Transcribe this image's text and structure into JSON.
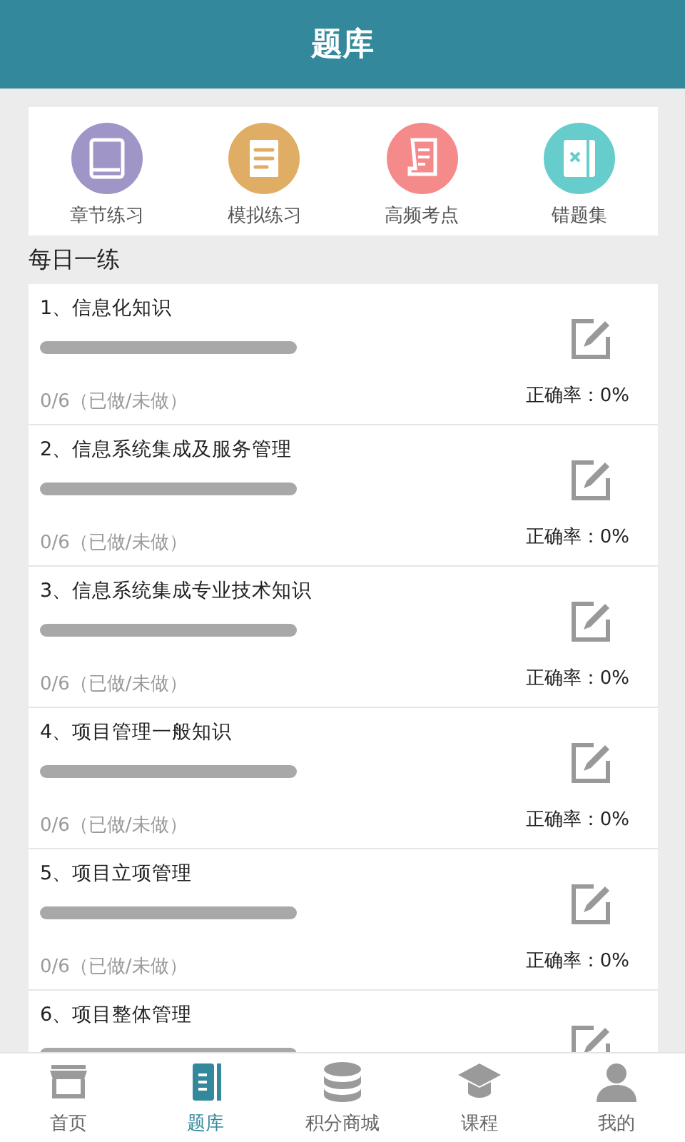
{
  "header": {
    "title": "题库"
  },
  "shortcuts": [
    {
      "label": "章节练习",
      "kind": "book",
      "color": "#9f95c6"
    },
    {
      "label": "模拟练习",
      "kind": "doc",
      "color": "#e0ad64"
    },
    {
      "label": "高频考点",
      "kind": "scroll",
      "color": "#f58a8a"
    },
    {
      "label": "错题集",
      "kind": "wrong",
      "color": "#66cccc"
    }
  ],
  "section": {
    "title": "每日一练"
  },
  "items": [
    {
      "title": "1、信息化知识",
      "level": 0,
      "stats": "0/6（已做/未做）",
      "accuracy": "正确率：0%"
    },
    {
      "title": "2、信息系统集成及服务管理",
      "level": 0,
      "stats": "0/6（已做/未做）",
      "accuracy": "正确率：0%"
    },
    {
      "title": "3、信息系统集成专业技术知识",
      "level": 0,
      "stats": "0/6（已做/未做）",
      "accuracy": "正确率：0%"
    },
    {
      "title": "4、项目管理一般知识",
      "level": 0,
      "stats": "0/6（已做/未做）",
      "accuracy": "正确率：0%"
    },
    {
      "title": "5、项目立项管理",
      "level": 0,
      "stats": "0/6（已做/未做）",
      "accuracy": "正确率：0%"
    },
    {
      "title": "6、项目整体管理",
      "level": 0
    }
  ],
  "nav": [
    {
      "label": "首页",
      "kind": "store",
      "selected": false
    },
    {
      "label": "题库",
      "kind": "book",
      "selected": true
    },
    {
      "label": "积分商城",
      "kind": "coins",
      "selected": false
    },
    {
      "label": "课程",
      "kind": "cap",
      "selected": false
    },
    {
      "label": "我的",
      "kind": "person",
      "selected": false
    }
  ]
}
